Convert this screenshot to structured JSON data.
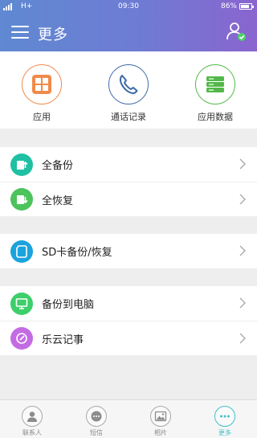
{
  "status_bar": {
    "network": "H+",
    "time": "09:30",
    "battery": "86%",
    "battery_level": 0.86
  },
  "header": {
    "title": "更多"
  },
  "quick_actions": [
    {
      "label": "应用",
      "icon": "apps-grid-icon",
      "color": "#f08a4b"
    },
    {
      "label": "通话记录",
      "icon": "phone-icon",
      "color": "#3d6aa8"
    },
    {
      "label": "应用数据",
      "icon": "database-icon",
      "color": "#53b84a"
    }
  ],
  "menu": [
    {
      "label": "全备份",
      "icon": "backup-upload-icon",
      "color": "#1fc0a4"
    },
    {
      "label": "全恢复",
      "icon": "restore-download-icon",
      "color": "#4cc35b"
    },
    {
      "label": "SD卡备份/恢复",
      "icon": "sd-card-icon",
      "color": "#1aa3dc"
    },
    {
      "label": "备份到电脑",
      "icon": "computer-monitor-icon",
      "color": "#3ccf6a"
    },
    {
      "label": "乐云记事",
      "icon": "note-pen-icon",
      "color": "#c46be3"
    }
  ],
  "tabs": [
    {
      "label": "联系人",
      "icon": "contact-icon"
    },
    {
      "label": "短信",
      "icon": "message-icon"
    },
    {
      "label": "相片",
      "icon": "photo-icon"
    },
    {
      "label": "更多",
      "icon": "more-icon",
      "active": true
    }
  ]
}
